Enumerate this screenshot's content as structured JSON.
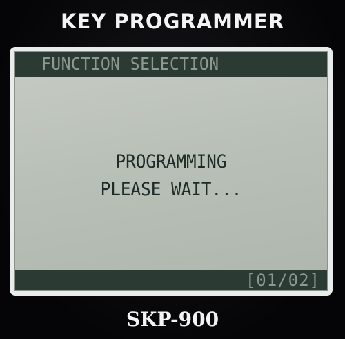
{
  "device": {
    "title": "KEY PROGRAMMER",
    "model": "SKP-900"
  },
  "screen": {
    "header": "FUNCTION SELECTION",
    "message": {
      "line1": "PROGRAMMING",
      "line2": "PLEASE WAIT..."
    },
    "page_indicator": "[01/02]"
  },
  "colors": {
    "lcd_background": "#bcc3ba",
    "lcd_bar": "#2c3a34",
    "lcd_text": "#1e2b26",
    "lcd_bar_text": "#8d9a92",
    "device_body": "#0a0a0c"
  }
}
